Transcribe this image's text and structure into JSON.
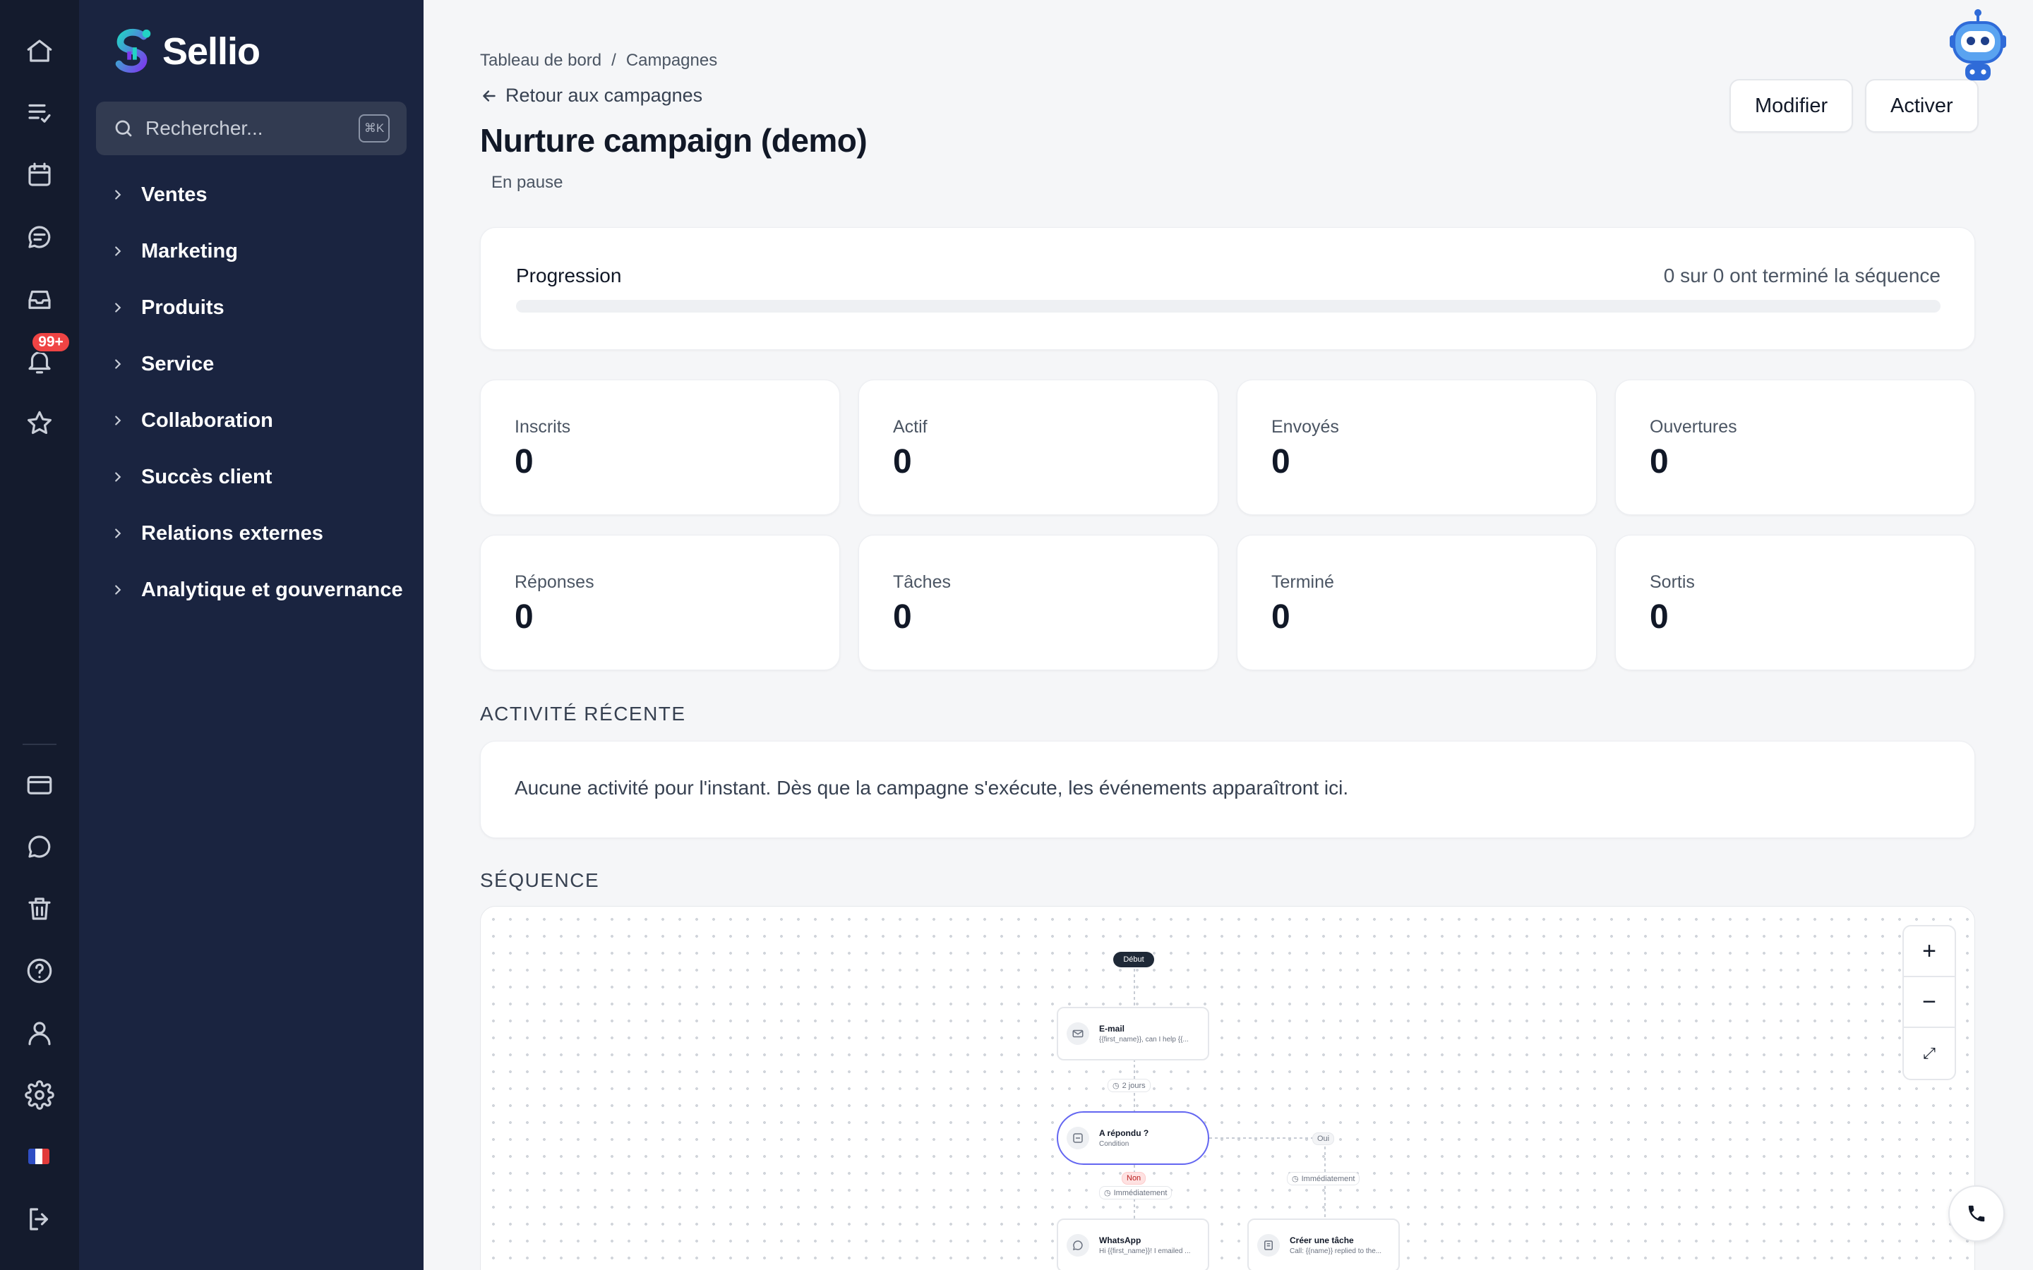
{
  "app": {
    "name": "Sellio"
  },
  "rail": {
    "notifications_badge": "99+"
  },
  "search": {
    "placeholder": "Rechercher...",
    "shortcut": "⌘K"
  },
  "nav": {
    "items": [
      {
        "label": "Ventes"
      },
      {
        "label": "Marketing"
      },
      {
        "label": "Produits"
      },
      {
        "label": "Service"
      },
      {
        "label": "Collaboration"
      },
      {
        "label": "Succès client"
      },
      {
        "label": "Relations externes"
      },
      {
        "label": "Analytique et gouvernance"
      }
    ]
  },
  "breadcrumb": {
    "home": "Tableau de bord",
    "separator": "/",
    "current": "Campagnes"
  },
  "page": {
    "back_label": "Retour aux campagnes",
    "title": "Nurture campaign (demo)",
    "status": "En pause",
    "edit_button": "Modifier",
    "activate_button": "Activer"
  },
  "progress": {
    "label": "Progression",
    "summary": "0 sur 0 ont terminé la séquence",
    "fraction": 0
  },
  "stats": [
    {
      "label": "Inscrits",
      "value": "0"
    },
    {
      "label": "Actif",
      "value": "0"
    },
    {
      "label": "Envoyés",
      "value": "0"
    },
    {
      "label": "Ouvertures",
      "value": "0"
    },
    {
      "label": "Réponses",
      "value": "0"
    },
    {
      "label": "Tâches",
      "value": "0"
    },
    {
      "label": "Terminé",
      "value": "0"
    },
    {
      "label": "Sortis",
      "value": "0"
    }
  ],
  "activity": {
    "title": "ACTIVITÉ RÉCENTE",
    "empty": "Aucune activité pour l'instant. Dès que la campagne s'exécute, les événements apparaîtront ici."
  },
  "sequence": {
    "title": "SÉQUENCE",
    "start": "Début",
    "email_title": "E-mail",
    "email_sub": "{{first_name}}, can I help {{...",
    "delay_1": "2 jours",
    "condition_title": "A répondu ?",
    "condition_sub": "Condition",
    "branch_yes": "Oui",
    "branch_no": "Non",
    "delay_no": "Immédiatement",
    "delay_yes": "Immédiatement",
    "whatsapp_title": "WhatsApp",
    "whatsapp_sub": "Hi {{first_name}}! I emailed ...",
    "task_title": "Créer une tâche",
    "task_sub": "Call: {{name}} replied to the...",
    "zoom_in": "+",
    "zoom_out": "−",
    "fit": "⤢"
  },
  "colors": {
    "rail_bg": "#141b2d",
    "nav_bg": "#1a2440",
    "badge": "#ef4444",
    "condition_border": "#6366f1"
  }
}
